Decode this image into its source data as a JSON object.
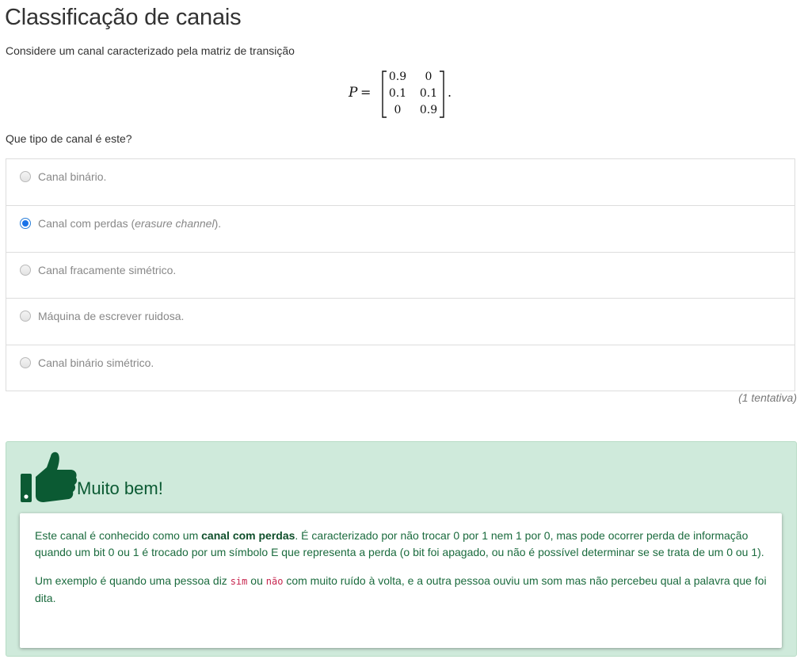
{
  "page": {
    "title": "Classificação de canais",
    "intro": "Considere um canal caracterizado pela matriz de transição",
    "question": "Que tipo de canal é este?"
  },
  "formula": {
    "symbol": "P",
    "equals": "=",
    "matrix": [
      [
        "0.9",
        "0"
      ],
      [
        "0.1",
        "0.1"
      ],
      [
        "0",
        "0.9"
      ]
    ],
    "trailing": "."
  },
  "options": [
    {
      "label": "Canal binário.",
      "selected": false
    },
    {
      "label_prefix": "Canal com perdas (",
      "label_italic": "erasure channel",
      "label_suffix": ").",
      "selected": true
    },
    {
      "label": "Canal fracamente simétrico.",
      "selected": false
    },
    {
      "label": "Máquina de escrever ruidosa.",
      "selected": false
    },
    {
      "label": "Canal binário simétrico.",
      "selected": false
    }
  ],
  "attempts": "(1 tentativa)",
  "feedback": {
    "icon": "thumbs-up-icon",
    "title": "Muito bem!",
    "p1_a": "Este canal é conhecido como um ",
    "p1_bold": "canal com perdas",
    "p1_b": ". É caracterizado por não trocar 0 por 1 nem 1 por 0, mas pode ocorrer perda de informação quando um bit 0 ou 1 é trocado por um símbolo E que representa a perda (o bit foi apagado, ou não é possível determinar se se trata de um 0 ou 1).",
    "p2_a": "Um exemplo é quando uma pessoa diz ",
    "p2_code1": "sim",
    "p2_b": " ou ",
    "p2_code2": "não",
    "p2_c": " com muito ruído à volta, e a outra pessoa ouviu um som mas não percebeu qual a palavra que foi dita."
  },
  "colors": {
    "success_bg": "#cfeadb",
    "success_text": "#0b5a33",
    "radio_selected": "#1a73e8",
    "code_text": "#c7254e"
  }
}
